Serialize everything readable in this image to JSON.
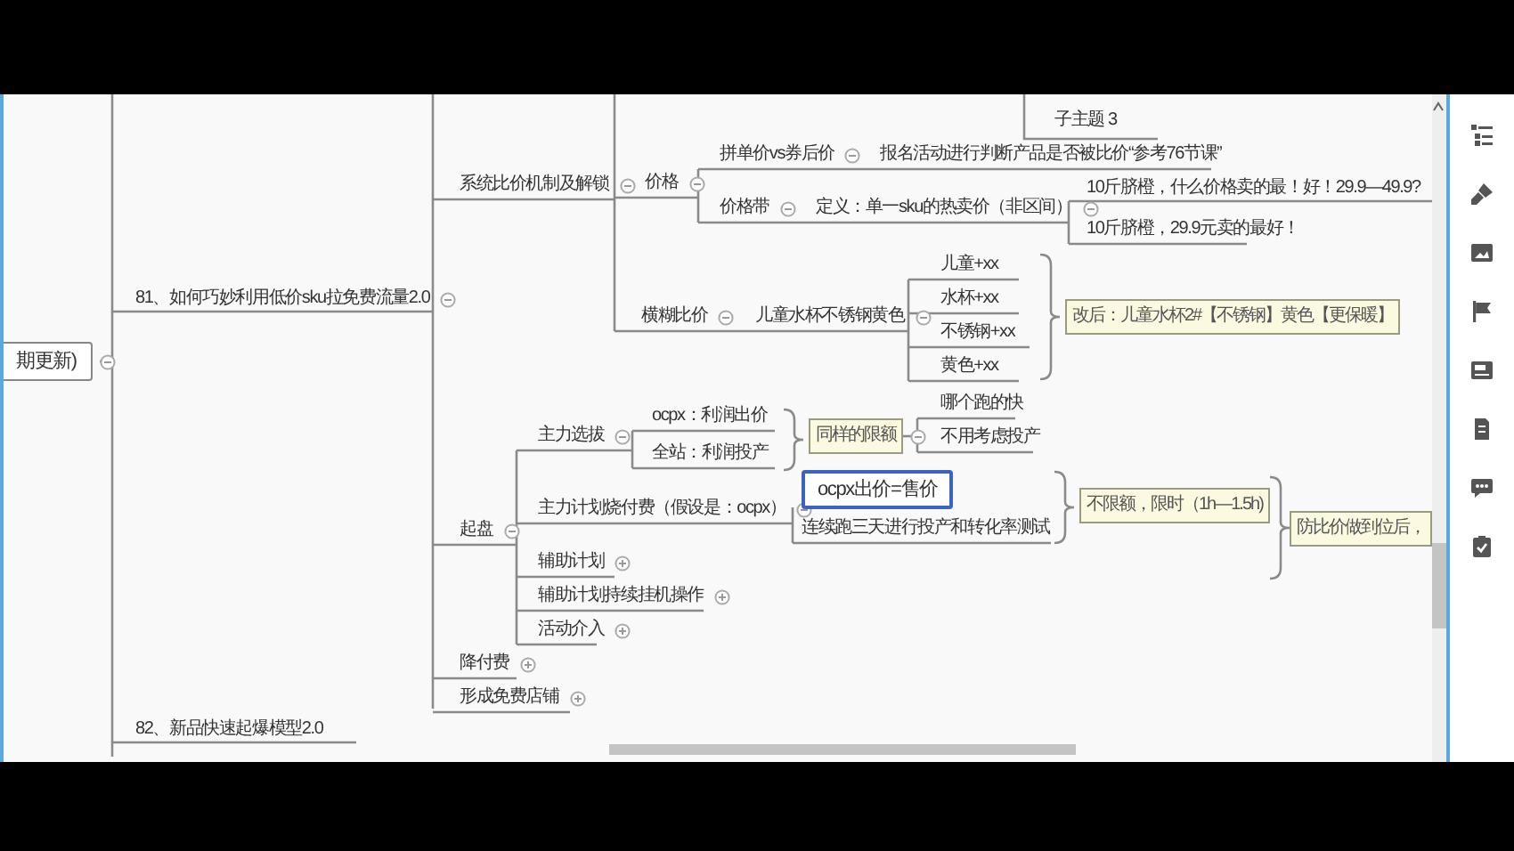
{
  "nodes": [
    {
      "text": "期更新)",
      "kind": "boxed",
      "selected": false,
      "collapsed": false
    },
    {
      "text": "81、如何巧妙利用低价sku拉免费流量2.0",
      "kind": "topic",
      "selected": false,
      "collapsed": false
    },
    {
      "text": "系统比价机制及解锁",
      "kind": "topic",
      "selected": false,
      "collapsed": false
    },
    {
      "text": "子主题 3",
      "kind": "topic",
      "selected": false
    },
    {
      "text": "价格",
      "kind": "topic",
      "selected": false,
      "collapsed": false
    },
    {
      "text": "拼单价vs券后价",
      "kind": "topic",
      "selected": false,
      "collapsed": false
    },
    {
      "text": "报名活动进行判断产品是否被比价“参考76节课”",
      "kind": "topic",
      "selected": false
    },
    {
      "text": "价格带",
      "kind": "topic",
      "selected": false,
      "collapsed": false
    },
    {
      "text": "定义：单一sku的热卖价（非区间）",
      "kind": "topic",
      "selected": false,
      "collapsed": false
    },
    {
      "text": "10斤脐橙，什么价格卖的最！好！29.9—49.9?",
      "kind": "topic",
      "selected": false
    },
    {
      "text": "10斤脐橙，29.9元卖的最好！",
      "kind": "topic",
      "selected": false
    },
    {
      "text": "横糊比价",
      "kind": "topic",
      "selected": false,
      "collapsed": false
    },
    {
      "text": "儿童水杯不锈钢黄色",
      "kind": "topic",
      "selected": false,
      "collapsed": false
    },
    {
      "text": "儿童+xx",
      "kind": "topic",
      "selected": false
    },
    {
      "text": "水杯+xx",
      "kind": "topic",
      "selected": false
    },
    {
      "text": "不锈钢+xx",
      "kind": "topic",
      "selected": false
    },
    {
      "text": "黄色+xx",
      "kind": "topic",
      "selected": false
    },
    {
      "text": "改后：儿童水杯2#【不锈钢】黄色【更保暖】",
      "kind": "callout",
      "selected": false
    },
    {
      "text": "起盘",
      "kind": "topic",
      "selected": false,
      "collapsed": false
    },
    {
      "text": "主力选拔",
      "kind": "topic",
      "selected": false,
      "collapsed": false
    },
    {
      "text": "ocpx：利润出价",
      "kind": "topic",
      "selected": false
    },
    {
      "text": "全站：利润投产",
      "kind": "topic",
      "selected": false
    },
    {
      "text": "同样的限额",
      "kind": "callout",
      "selected": false,
      "collapsed": false
    },
    {
      "text": "哪个跑的快",
      "kind": "topic",
      "selected": false
    },
    {
      "text": "不用考虑投产",
      "kind": "topic",
      "selected": false
    },
    {
      "text": "主力计划烧付费（假设是：ocpx）",
      "kind": "topic",
      "selected": false,
      "collapsed": false
    },
    {
      "text": "ocpx出价=售价",
      "kind": "boxed",
      "selected": true
    },
    {
      "text": "连续跑三天进行投产和转化率测试",
      "kind": "topic",
      "selected": false
    },
    {
      "text": "不限额，限时（1h—1.5h)",
      "kind": "callout",
      "selected": false
    },
    {
      "text": "防比价做到位后，",
      "kind": "callout",
      "selected": false
    },
    {
      "text": "辅助计划",
      "kind": "topic",
      "selected": false,
      "collapsed": true
    },
    {
      "text": "辅助计划持续挂机操作",
      "kind": "topic",
      "selected": false,
      "collapsed": true
    },
    {
      "text": "活动介入",
      "kind": "topic",
      "selected": false,
      "collapsed": true
    },
    {
      "text": "降付费",
      "kind": "topic",
      "selected": false,
      "collapsed": true
    },
    {
      "text": "形成免费店铺",
      "kind": "topic",
      "selected": false,
      "collapsed": true
    },
    {
      "text": "82、新品快速起爆模型2.0",
      "kind": "topic",
      "selected": false
    }
  ]
}
